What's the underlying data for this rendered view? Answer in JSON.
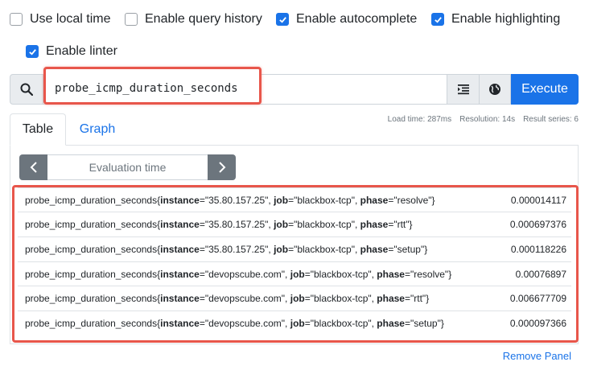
{
  "options": [
    {
      "label": "Use local time",
      "checked": false
    },
    {
      "label": "Enable query history",
      "checked": false
    },
    {
      "label": "Enable autocomplete",
      "checked": true
    },
    {
      "label": "Enable highlighting",
      "checked": true
    },
    {
      "label": "Enable linter",
      "checked": true
    }
  ],
  "query": {
    "expression": "probe_icmp_duration_seconds"
  },
  "execute_label": "Execute",
  "tabs": {
    "table": "Table",
    "graph": "Graph"
  },
  "stats": {
    "load_time": "Load time: 287ms",
    "resolution": "Resolution: 14s",
    "result_series": "Result series: 6"
  },
  "evaluation_time_placeholder": "Evaluation time",
  "results": [
    {
      "metric": "probe_icmp_duration_seconds",
      "open": "{",
      "k1": "instance",
      "v1": "=\"35.80.157.25\", ",
      "k2": "job",
      "v2": "=\"blackbox-tcp\", ",
      "k3": "phase",
      "v3": "=\"resolve\"",
      "close": "}",
      "value": "0.000014117"
    },
    {
      "metric": "probe_icmp_duration_seconds",
      "open": "{",
      "k1": "instance",
      "v1": "=\"35.80.157.25\", ",
      "k2": "job",
      "v2": "=\"blackbox-tcp\", ",
      "k3": "phase",
      "v3": "=\"rtt\"",
      "close": "}",
      "value": "0.000697376"
    },
    {
      "metric": "probe_icmp_duration_seconds",
      "open": "{",
      "k1": "instance",
      "v1": "=\"35.80.157.25\", ",
      "k2": "job",
      "v2": "=\"blackbox-tcp\", ",
      "k3": "phase",
      "v3": "=\"setup\"",
      "close": "}",
      "value": "0.000118226"
    },
    {
      "metric": "probe_icmp_duration_seconds",
      "open": "{",
      "k1": "instance",
      "v1": "=\"devopscube.com\", ",
      "k2": "job",
      "v2": "=\"blackbox-tcp\", ",
      "k3": "phase",
      "v3": "=\"resolve\"",
      "close": "}",
      "value": "0.00076897"
    },
    {
      "metric": "probe_icmp_duration_seconds",
      "open": "{",
      "k1": "instance",
      "v1": "=\"devopscube.com\", ",
      "k2": "job",
      "v2": "=\"blackbox-tcp\", ",
      "k3": "phase",
      "v3": "=\"rtt\"",
      "close": "}",
      "value": "0.006677709"
    },
    {
      "metric": "probe_icmp_duration_seconds",
      "open": "{",
      "k1": "instance",
      "v1": "=\"devopscube.com\", ",
      "k2": "job",
      "v2": "=\"blackbox-tcp\", ",
      "k3": "phase",
      "v3": "=\"setup\"",
      "close": "}",
      "value": "0.000097366"
    }
  ],
  "remove_panel_label": "Remove Panel",
  "colors": {
    "accent": "#1a73e8",
    "highlight": "#e8564b"
  }
}
